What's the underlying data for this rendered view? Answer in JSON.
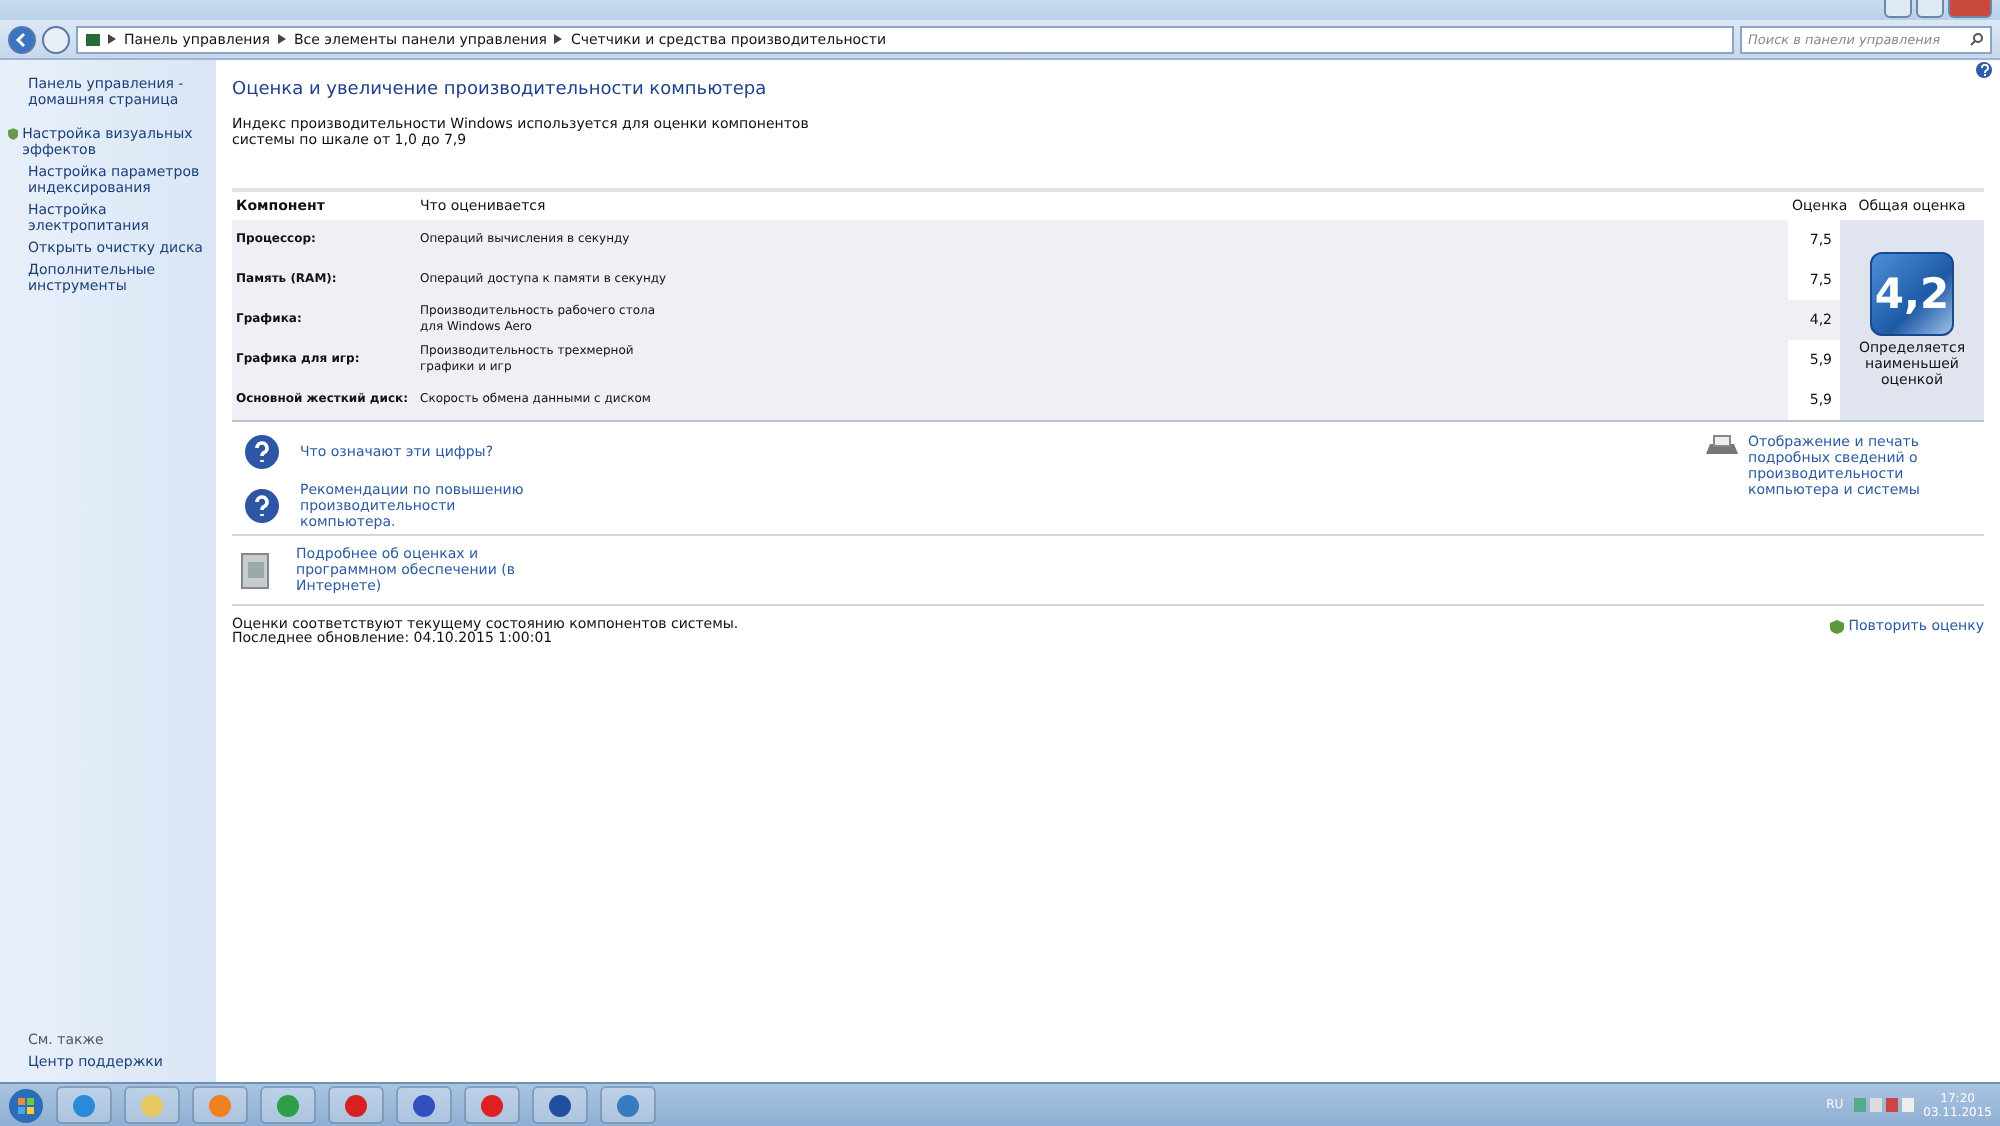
{
  "address_bar": {
    "breadcrumbs": [
      "Панель управления",
      "Все элементы панели управления",
      "Счетчики и средства производительности"
    ],
    "search": {
      "placeholder": "Поиск в панели управления"
    }
  },
  "sidebar": {
    "items": [
      {
        "label": "Панель управления - домашняя страница",
        "kind": "plain"
      },
      {
        "label": "Настройка визуальных эффектов",
        "kind": "shield"
      },
      {
        "label": "Настройка параметров индексирования",
        "kind": "plain"
      },
      {
        "label": "Настройка электропитания",
        "kind": "plain"
      },
      {
        "label": "Открыть очистку диска",
        "kind": "plain"
      },
      {
        "label": "Дополнительные инструменты",
        "kind": "plain"
      }
    ],
    "see_also": {
      "heading": "См. также",
      "items": [
        "Центр поддержки"
      ]
    }
  },
  "title": "Оценка и увеличение производительности компьютера",
  "description": "Индекс производительности Windows используется для оценки компонентов системы по шкале от 1,0 до 7,9",
  "table": {
    "columns": [
      "Компонент",
      "Что оценивается",
      "Оценка",
      "Общая оценка"
    ],
    "rows": [
      {
        "component": "Процессор:",
        "measures": "Операций вычисления в секунду",
        "score": "7,5",
        "lowest": false
      },
      {
        "component": "Память (RAM):",
        "measures": "Операций доступа к памяти в секунду",
        "score": "7,5",
        "lowest": false
      },
      {
        "component": "Графика:",
        "measures": "Производительность рабочего стола для Windows Aero",
        "score": "4,2",
        "lowest": true
      },
      {
        "component": "Графика для игр:",
        "measures": "Производительность трехмерной графики и игр",
        "score": "5,9",
        "lowest": false
      },
      {
        "component": "Основной жесткий диск:",
        "measures": "Скорость обмена данными с диском",
        "score": "5,9",
        "lowest": false
      }
    ],
    "base_score": "4,2",
    "base_note": "Определяется наименьшей оценкой"
  },
  "help_links": [
    {
      "label": "Что означают эти цифры?",
      "kind": "help"
    },
    {
      "label": "Рекомендации по повышению производительности компьютера.",
      "kind": "help"
    }
  ],
  "print_link": "Отображение и печать подробных сведений о производительности компьютера и системы",
  "online_link": "Подробнее об оценках и программном обеспечении (в Интернете)",
  "status": [
    "Оценки соответствуют текущему состоянию компонентов системы.",
    "Последнее обновление: 04.10.2015 1:00:01"
  ],
  "rerun": "Повторить оценку",
  "taskbar": {
    "apps": [
      {
        "kind": "ie"
      },
      {
        "kind": "explorer"
      },
      {
        "kind": "media"
      },
      {
        "kind": "chrome"
      },
      {
        "kind": "yandex"
      },
      {
        "kind": "browser"
      },
      {
        "kind": "yabrowser"
      },
      {
        "kind": "word"
      },
      {
        "kind": "remote"
      }
    ],
    "language": "RU",
    "time": "17:20",
    "date": "03.11.2015"
  }
}
